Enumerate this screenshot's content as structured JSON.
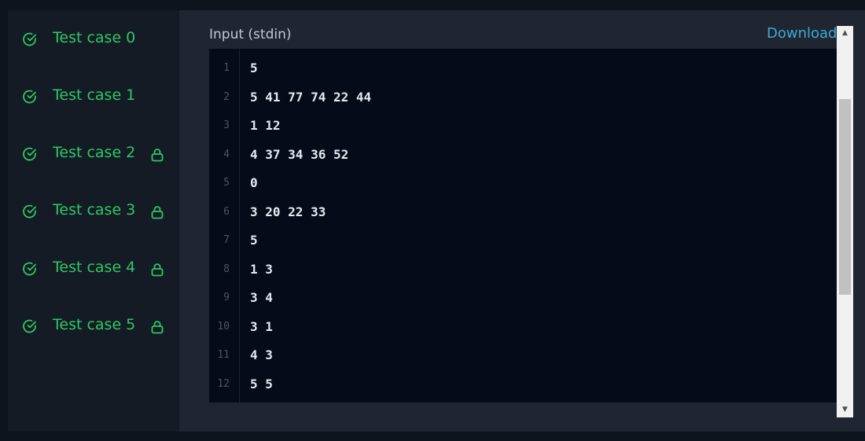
{
  "sidebar": {
    "test_cases": [
      {
        "label": "Test case 0",
        "active": true,
        "locked": false
      },
      {
        "label": "Test case 1",
        "active": false,
        "locked": false
      },
      {
        "label": "Test case 2",
        "active": false,
        "locked": true
      },
      {
        "label": "Test case 3",
        "active": false,
        "locked": true
      },
      {
        "label": "Test case 4",
        "active": false,
        "locked": true
      },
      {
        "label": "Test case 5",
        "active": false,
        "locked": true
      }
    ]
  },
  "panel": {
    "title": "Input (stdin)",
    "download_label": "Download"
  },
  "editor": {
    "lines": [
      {
        "num": "1",
        "text": "5"
      },
      {
        "num": "2",
        "text": "5 41 77 74 22 44"
      },
      {
        "num": "3",
        "text": "1 12"
      },
      {
        "num": "4",
        "text": "4 37 34 36 52"
      },
      {
        "num": "5",
        "text": "0"
      },
      {
        "num": "6",
        "text": "3 20 22 33"
      },
      {
        "num": "7",
        "text": "5"
      },
      {
        "num": "8",
        "text": "1 3"
      },
      {
        "num": "9",
        "text": "3 4"
      },
      {
        "num": "10",
        "text": "3 1"
      },
      {
        "num": "11",
        "text": "4 3"
      },
      {
        "num": "12",
        "text": "5 5"
      }
    ]
  },
  "icons": {
    "check": "check-circle-icon",
    "lock": "lock-icon",
    "scroll_up": "triangle-up-icon",
    "scroll_down": "triangle-down-icon"
  },
  "colors": {
    "accent_green": "#2ec866",
    "link_blue": "#3ea9d3",
    "editor_bg": "#050b18",
    "sidebar_bg": "#141b25",
    "panel_bg": "#1f2631"
  }
}
